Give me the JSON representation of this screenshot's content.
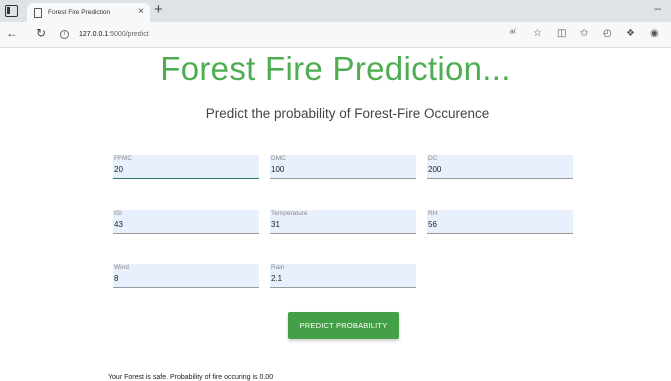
{
  "browser": {
    "tab_title": "Forest Fire Prediction",
    "tab_close": "×",
    "new_tab": "+",
    "minimize": "–",
    "url_host": "127.0.0.1",
    "url_path": ":5000/predict"
  },
  "page": {
    "title": "Forest Fire Prediction...",
    "subtitle": "Predict the probability of Forest-Fire Occurence",
    "fields": [
      {
        "label": "FFMC",
        "value": "20"
      },
      {
        "label": "DMC",
        "value": "100"
      },
      {
        "label": "DC",
        "value": "200"
      },
      {
        "label": "ISI",
        "value": "43"
      },
      {
        "label": "Temperature",
        "value": "31"
      },
      {
        "label": "RH",
        "value": "56"
      },
      {
        "label": "Wind",
        "value": "8"
      },
      {
        "label": "Rain",
        "value": "2.1"
      }
    ],
    "button_label": "PREDICT PROBABILITY",
    "result_text": "Your Forest is safe. Probability of fire occuring is 0.00"
  },
  "colors": {
    "title_green": "#4cae50",
    "button_green": "#43a047",
    "field_bg": "#e8f0fe"
  }
}
